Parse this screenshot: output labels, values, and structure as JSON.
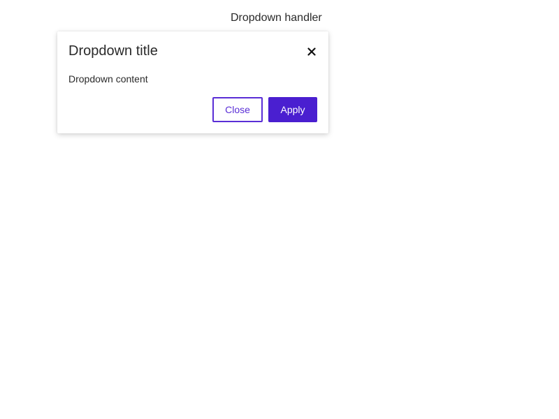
{
  "handler": {
    "label": "Dropdown handler"
  },
  "dropdown": {
    "title": "Dropdown title",
    "content": "Dropdown content",
    "close_icon": "close-icon",
    "buttons": {
      "close_label": "Close",
      "apply_label": "Apply"
    }
  },
  "colors": {
    "accent": "#4a1fd0",
    "accent_outline": "#5a2ed6",
    "text": "#2a2a2a",
    "background": "#ffffff"
  }
}
